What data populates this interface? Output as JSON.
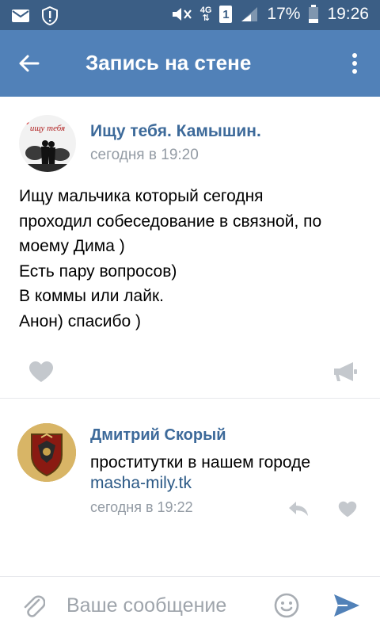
{
  "status_bar": {
    "battery": "17%",
    "time": "19:26",
    "network": "4G",
    "sim_slot": "1"
  },
  "header": {
    "title": "Запись на стене",
    "background": "#5181b8"
  },
  "post": {
    "avatar_caption": "ищу тебя",
    "author": "Ищу тебя. Камышин.",
    "time": "сегодня в 19:20",
    "text_lines": [
      "Ищу мальчика который сегодня",
      "проходил собеседование в связной, по",
      "моему Дима )",
      "Есть пару вопросов)",
      "В коммы или лайк.",
      "Анон) спасибо )"
    ]
  },
  "comment": {
    "author": "Дмитрий Скорый",
    "text": "проститутки в нашем городе",
    "link": "masha-mily.tk",
    "time": "сегодня в 19:22"
  },
  "composer": {
    "placeholder": "Ваше сообщение"
  },
  "colors": {
    "accent": "#5181b8",
    "status_bar": "#3b5e85",
    "author_link": "#3d6a9a",
    "meta_gray": "#939ba4",
    "icon_gray": "#c4c8cd"
  },
  "icons": [
    "mail-icon",
    "alert-icon",
    "mute-icon",
    "signal-icon",
    "battery-icon",
    "back-arrow-icon",
    "more-vertical-icon",
    "heart-icon",
    "megaphone-icon",
    "reply-icon",
    "paperclip-icon",
    "smile-icon",
    "send-icon"
  ]
}
